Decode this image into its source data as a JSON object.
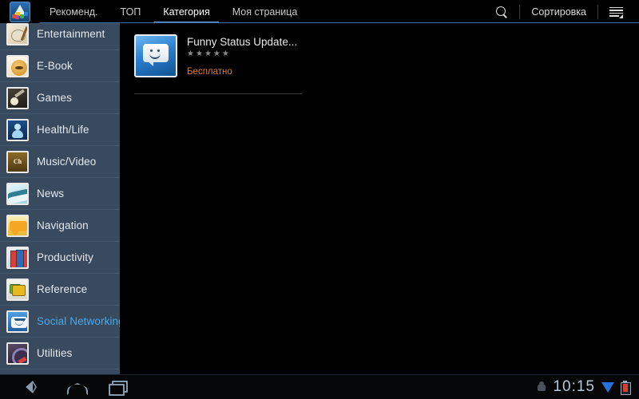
{
  "actionbar": {
    "logo_icon": "samsung-apps-logo",
    "tabs": [
      {
        "label": "Рекоменд.",
        "active": false
      },
      {
        "label": "ТОП",
        "active": false
      },
      {
        "label": "Категория",
        "active": true
      },
      {
        "label": "Моя страница",
        "active": false
      }
    ],
    "search_icon": "search-icon",
    "sort_label": "Сортировка",
    "menu_icon": "list-menu-icon",
    "accent_color": "#5a9de0"
  },
  "sidebar": {
    "items": [
      {
        "label": "Entertainment",
        "icon": "entertainment-category-icon",
        "icon_class": "ic-entertainment",
        "icon_text": "",
        "selected": false
      },
      {
        "label": "E-Book",
        "icon": "ebook-category-icon",
        "icon_class": "ic-ebook",
        "icon_text": "",
        "selected": false
      },
      {
        "label": "Games",
        "icon": "games-category-icon",
        "icon_class": "ic-games",
        "icon_text": "",
        "selected": false
      },
      {
        "label": "Health/Life",
        "icon": "health-category-icon",
        "icon_class": "ic-health",
        "icon_text": "",
        "selected": false
      },
      {
        "label": "Music/Video",
        "icon": "music-video-category-icon",
        "icon_class": "ic-music",
        "icon_text": "Ch",
        "selected": false
      },
      {
        "label": "News",
        "icon": "news-category-icon",
        "icon_class": "ic-news",
        "icon_text": "",
        "selected": false
      },
      {
        "label": "Navigation",
        "icon": "navigation-category-icon",
        "icon_class": "ic-nav",
        "icon_text": "",
        "selected": false
      },
      {
        "label": "Productivity",
        "icon": "productivity-category-icon",
        "icon_class": "ic-prod",
        "icon_text": "",
        "selected": false
      },
      {
        "label": "Reference",
        "icon": "reference-category-icon",
        "icon_class": "ic-ref",
        "icon_text": "",
        "selected": false
      },
      {
        "label": "Social Networking",
        "icon": "social-networking-category-icon",
        "icon_class": "ic-social",
        "icon_text": "",
        "selected": true
      },
      {
        "label": "Utilities",
        "icon": "utilities-category-icon",
        "icon_class": "ic-util",
        "icon_text": "",
        "selected": false
      }
    ],
    "selected_color": "#4aa8e8",
    "background_color": "#3a4a5e"
  },
  "content": {
    "apps": [
      {
        "title": "Funny Status Update...",
        "icon": "smiley-chat-bubble-icon",
        "rating": 0,
        "max_rating": 5,
        "price": "Бесплатно",
        "price_color": "#e07b20"
      }
    ]
  },
  "systembar": {
    "back_icon": "back-icon",
    "home_icon": "home-icon",
    "recent_icon": "recent-apps-icon",
    "android_icon": "android-robot-icon",
    "clock": "10:15",
    "signal_icon": "signal-down-icon",
    "battery_icon": "battery-icon"
  }
}
